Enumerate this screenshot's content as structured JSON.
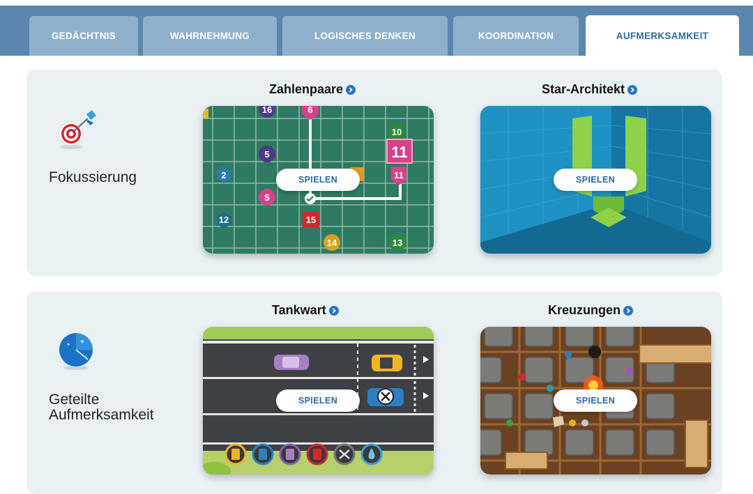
{
  "tabs": [
    {
      "label": "GEDÄCHTNIS",
      "active": false
    },
    {
      "label": "WAHRNEHMUNG",
      "active": false
    },
    {
      "label": "LOGISCHES DENKEN",
      "active": false
    },
    {
      "label": "KOORDINATION",
      "active": false
    },
    {
      "label": "AUFMERKSAMKEIT",
      "active": true
    }
  ],
  "sections": [
    {
      "label": "Fokussierung",
      "icon": "target-dart-icon",
      "games": [
        {
          "title": "Zahlenpaare",
          "play_label": "SPIELEN",
          "board_numbers": [
            "16",
            "6",
            "10",
            "11",
            "5",
            "2",
            "11",
            "5",
            "12",
            "15",
            "14",
            "13"
          ]
        },
        {
          "title": "Star-Architekt",
          "play_label": "SPIELEN"
        }
      ]
    },
    {
      "label": "Geteilte Aufmerksamkeit",
      "icon": "radar-globe-icon",
      "games": [
        {
          "title": "Tankwart",
          "play_label": "SPIELEN"
        },
        {
          "title": "Kreuzungen",
          "play_label": "SPIELEN"
        }
      ]
    }
  ],
  "colors": {
    "tab_bar": "#5a87ae",
    "tab_inactive": "#8fb0cb",
    "tab_active_text": "#2b6aa6",
    "section_bg": "#e9f1f5",
    "play_text": "#2a67a8",
    "info_dot": "#2b74c4"
  }
}
